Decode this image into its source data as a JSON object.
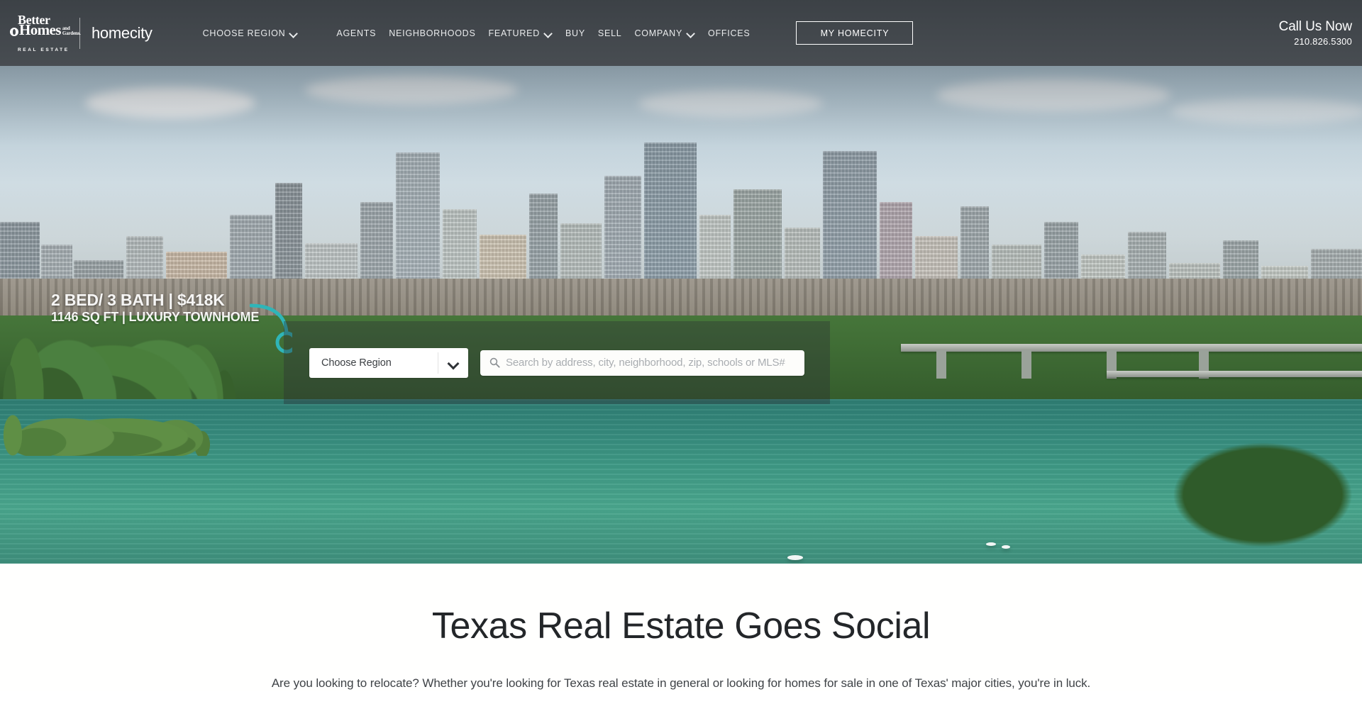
{
  "header": {
    "logo": {
      "brand_line1": "Better",
      "brand_line2": "Homes",
      "brand_line3": "and Gardens.",
      "brand_line4": "REAL ESTATE",
      "sub_brand": "homecity",
      "leaf_icon": "leaf-icon"
    },
    "nav": [
      {
        "label": "CHOOSE REGION",
        "has_dropdown": true
      },
      {
        "label": "AGENTS",
        "has_dropdown": false
      },
      {
        "label": "NEIGHBORHOODS",
        "has_dropdown": false
      },
      {
        "label": "FEATURED",
        "has_dropdown": true
      },
      {
        "label": "BUY",
        "has_dropdown": false
      },
      {
        "label": "SELL",
        "has_dropdown": false
      },
      {
        "label": "COMPANY",
        "has_dropdown": true
      },
      {
        "label": "OFFICES",
        "has_dropdown": false
      }
    ],
    "my_homecity_button": "MY HOMECITY",
    "call": {
      "title": "Call Us Now",
      "number": "210.826.5300"
    },
    "background_color": "#474c51"
  },
  "hero": {
    "video_caption": {
      "line1": "2 BED/ 3 BATH  |  $418K",
      "line2": "1146 SQ FT  |  LUXURY TOWNHOME"
    },
    "search": {
      "region_selected": "Choose Region",
      "region_caret_icon": "chevron-down-icon",
      "search_icon": "search-icon",
      "search_value": "",
      "search_placeholder": "Search by address, city, neighborhood, zip, schools or MLS#"
    }
  },
  "intro": {
    "title": "Texas Real Estate Goes Social",
    "paragraph": "Are you looking to relocate? Whether you're looking for Texas real estate in general or looking for homes for sale in one of Texas' major cities, you're in luck."
  },
  "colors": {
    "header_bg": "#474c51",
    "accent_white": "#ffffff",
    "text_dark": "#232629",
    "water": "#3f9a86",
    "foliage": "#46763a"
  }
}
